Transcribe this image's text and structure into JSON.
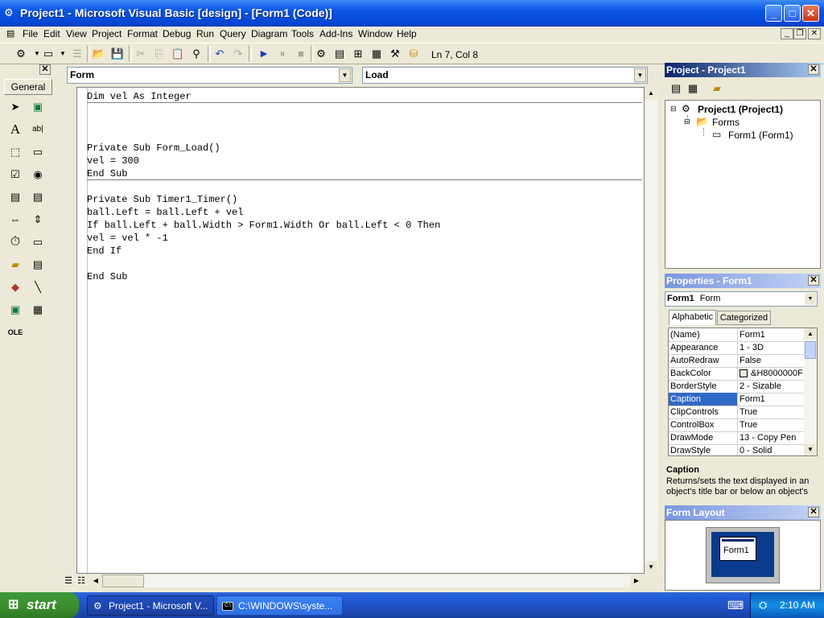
{
  "window": {
    "title": "Project1 - Microsoft Visual Basic [design] - [Form1 (Code)]",
    "minimize": "_",
    "maximize": "□",
    "close": "✕"
  },
  "menu": {
    "items": [
      "File",
      "Edit",
      "View",
      "Project",
      "Format",
      "Debug",
      "Run",
      "Query",
      "Diagram",
      "Tools",
      "Add-Ins",
      "Window",
      "Help"
    ]
  },
  "toolbar": {
    "ln_col": "Ln 7, Col 8"
  },
  "toolbox": {
    "tab_label": "General"
  },
  "code": {
    "object_combo": "Form",
    "procedure_combo": "Load",
    "lines": [
      "Dim vel As Integer",
      "",
      "",
      "",
      "Private Sub Form_Load()",
      "vel = 300",
      "End Sub",
      "",
      "Private Sub Timer1_Timer()",
      "ball.Left = ball.Left + vel",
      "If ball.Left + ball.Width > Form1.Width Or ball.Left < 0 Then",
      "vel = vel * -1",
      "End If",
      "",
      "End Sub"
    ]
  },
  "project_panel": {
    "title": "Project - Project1",
    "tree": {
      "root": "Project1 (Project1)",
      "folder": "Forms",
      "item": "Form1 (Form1)"
    }
  },
  "properties_panel": {
    "title": "Properties - Form1",
    "object_name": "Form1",
    "object_type": "Form",
    "tabs": [
      "Alphabetic",
      "Categorized"
    ],
    "rows": [
      {
        "name": "(Name)",
        "value": "Form1"
      },
      {
        "name": "Appearance",
        "value": "1 - 3D"
      },
      {
        "name": "AutoRedraw",
        "value": "False"
      },
      {
        "name": "BackColor",
        "value": "&H8000000F"
      },
      {
        "name": "BorderStyle",
        "value": "2 - Sizable"
      },
      {
        "name": "Caption",
        "value": "Form1"
      },
      {
        "name": "ClipControls",
        "value": "True"
      },
      {
        "name": "ControlBox",
        "value": "True"
      },
      {
        "name": "DrawMode",
        "value": "13 - Copy Pen"
      },
      {
        "name": "DrawStyle",
        "value": "0 - Solid"
      }
    ],
    "selected_property": "Caption",
    "description_title": "Caption",
    "description": "Returns/sets the text displayed in an object's title bar or below an object's"
  },
  "form_layout": {
    "title": "Form Layout",
    "form_label": "Form1"
  },
  "taskbar": {
    "start_label": "start",
    "tasks": [
      "Project1 - Microsoft V...",
      "C:\\WINDOWS\\syste..."
    ],
    "clock": "2:10 AM"
  },
  "colors": {
    "titlebar": "#0a54e3",
    "panel_active": "#0a246a",
    "selection": "#316ac5",
    "taskbar": "#245edb",
    "start": "#3c8f2f"
  }
}
